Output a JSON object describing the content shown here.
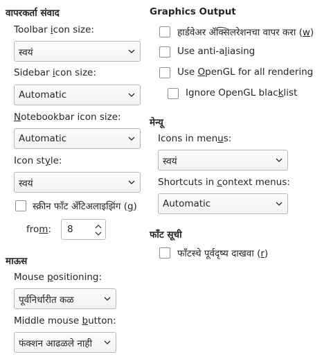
{
  "left": {
    "user_interface": {
      "heading": "वापरकर्ता संवाद",
      "toolbar_icon_size": {
        "label_pre": "Toolbar ",
        "label_u": "i",
        "label_post": "con size:",
        "value": "स्वयं"
      },
      "sidebar_icon_size": {
        "label_pre": "Sidebar ",
        "label_u": "i",
        "label_post": "con size:",
        "value": "Automatic"
      },
      "notebookbar_icon_size": {
        "label_pre": "",
        "label_u": "N",
        "label_post": "otebookbar icon size:",
        "value": "Automatic"
      },
      "icon_style": {
        "label_pre": "Icon st",
        "label_u": "y",
        "label_post": "le:",
        "value": "स्वयं"
      },
      "screen_font_antialiasing": {
        "label_pre": "स्क्रीन फॉंट अँटिअलाइझिंग (",
        "label_u": "g",
        "label_post": ")",
        "checked": false
      },
      "from": {
        "label_pre": "fro",
        "label_u": "m",
        "label_post": ":",
        "value": "8"
      }
    },
    "mouse": {
      "heading": "माऊस",
      "mouse_positioning": {
        "label_pre": "Mouse ",
        "label_u": "p",
        "label_post": "ositioning:",
        "value": "पूर्वनिर्धारीत कळ"
      },
      "middle_mouse_button": {
        "label_pre": "Middle mouse ",
        "label_u": "b",
        "label_post": "utton:",
        "value": "फंक्शन आढळले नाही"
      }
    }
  },
  "right": {
    "graphics_output": {
      "heading": "Graphics Output",
      "hardware_acceleration": {
        "label_pre": "हार्डवेअर ॲक्सिलरेशनचा वापर करा (",
        "label_u": "w",
        "label_post": ")",
        "checked": false
      },
      "anti_aliasing": {
        "label_pre": "Use anti-a",
        "label_u": "l",
        "label_post": "iasing",
        "checked": false
      },
      "opengl": {
        "label_pre": "Use ",
        "label_u": "O",
        "label_post": "penGL for all rendering",
        "checked": false
      },
      "opengl_blacklist": {
        "label_pre": "Ignore OpenGL blac",
        "label_u": "k",
        "label_post": "list",
        "checked": false
      }
    },
    "menu": {
      "heading": "मेन्यू",
      "icons_in_menus": {
        "label_pre": "Icons in men",
        "label_u": "u",
        "label_post": "s:",
        "value": "स्वयं"
      },
      "shortcuts_in_context_menus": {
        "label_pre": "Shortcuts in ",
        "label_u": "c",
        "label_post": "ontext menus:",
        "value": "Automatic"
      }
    },
    "font_lists": {
      "heading": "फाँट सूची",
      "font_preview": {
        "label_pre": "फाँटस्चे पूर्वदृष्य दाखवा (",
        "label_u": "r",
        "label_post": ")",
        "checked": false
      }
    }
  }
}
